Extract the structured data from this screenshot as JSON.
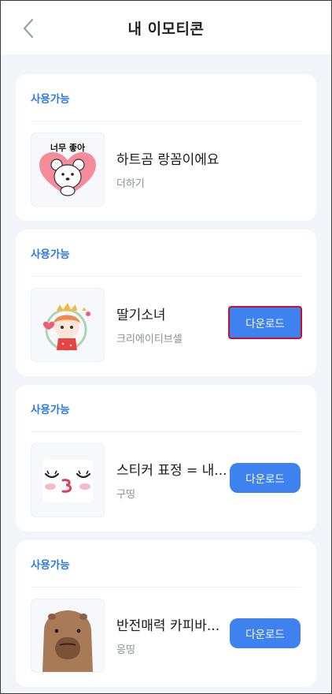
{
  "header": {
    "title": "내 이모티콘"
  },
  "cards": [
    {
      "status": "사용가능",
      "name": "하트곰 랑꼼이에요",
      "creator": "더하기",
      "thumb_text": "너무 좋아"
    },
    {
      "status": "사용가능",
      "name": "딸기소녀",
      "creator": "크리에이티브셀",
      "button": "다운로드"
    },
    {
      "status": "사용가능",
      "name": "스티커 표정 = 내...",
      "creator": "구띵",
      "button": "다운로드"
    },
    {
      "status": "사용가능",
      "name": "반전매력 카피바...",
      "creator": "응띵",
      "button": "다운로드"
    }
  ],
  "colors": {
    "accent": "#3d82ee",
    "label": "#2f7be0",
    "background": "#f2f5fa",
    "focus": "#c8102e"
  }
}
